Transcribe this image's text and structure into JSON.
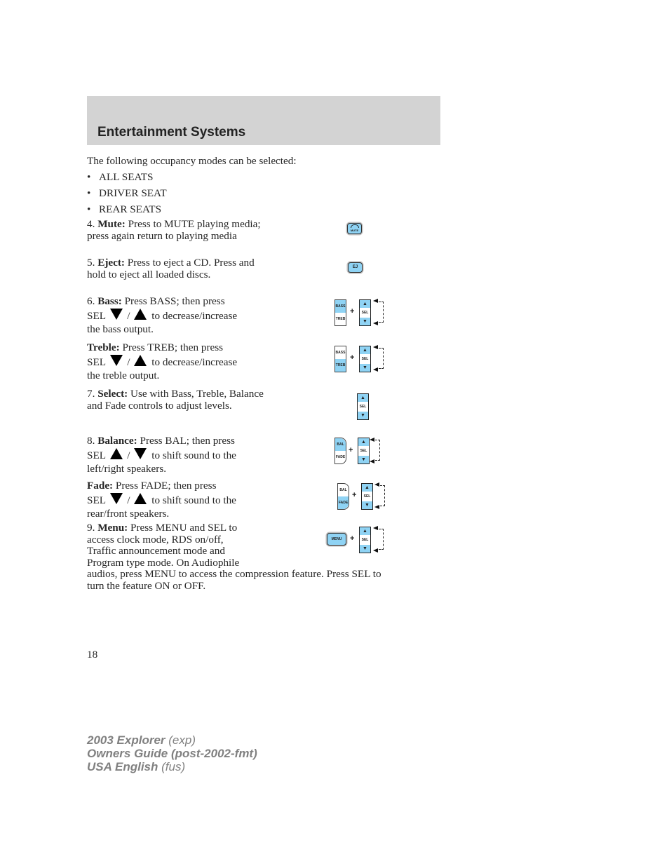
{
  "header": {
    "title": "Entertainment Systems"
  },
  "intro": "The following occupancy modes can be selected:",
  "occupancy_modes": [
    "ALL SEATS",
    "DRIVER SEAT",
    "REAR SEATS"
  ],
  "items": {
    "mute": {
      "num": "4.",
      "term": "Mute:",
      "text": "Press to MUTE playing media; press again return to playing media",
      "button_label": "MUTE"
    },
    "eject": {
      "num": "5.",
      "term": "Eject:",
      "text": "Press to eject a CD. Press and hold to eject all loaded discs.",
      "button_label": "EJ"
    },
    "bass": {
      "num": "6.",
      "term": "Bass:",
      "text_a": "Press BASS; then press",
      "text_b": "SEL",
      "text_c": "to decrease/increase",
      "text_d": "the bass output."
    },
    "treble": {
      "term": "Treble:",
      "text_a": "Press TREB; then press",
      "text_b": "SEL",
      "text_c": "to decrease/increase",
      "text_d": "the treble output."
    },
    "select": {
      "num": "7.",
      "term": "Select:",
      "text": "Use with Bass, Treble, Balance and Fade controls to adjust levels."
    },
    "balance": {
      "num": "8.",
      "term": "Balance:",
      "text_a": "Press BAL; then press",
      "text_b": "SEL",
      "text_c": "to shift sound to the",
      "text_d": "left/right speakers."
    },
    "fade": {
      "term": "Fade:",
      "text_a": "Press FADE; then press",
      "text_b": "SEL",
      "text_c": "to shift sound to the",
      "text_d": "rear/front speakers."
    },
    "menu": {
      "num": "9.",
      "term": "Menu:",
      "lines": [
        "Press MENU and SEL to",
        "access clock mode, RDS on/off,",
        "Traffic announcement mode and",
        "Program type mode. On Audiophile",
        "audios, press MENU to access the compression feature. Press SEL to",
        "turn the feature ON or OFF."
      ]
    }
  },
  "slash": "/",
  "buttons": {
    "bass": "BASS",
    "treb": "TREB",
    "sel": "SEL",
    "bal": "BAL",
    "fade": "FADE",
    "menu": "MENU",
    "up": "▲",
    "down": "▼",
    "plus": "+"
  },
  "colors": {
    "button_blue": "#8fd3f4",
    "header_gray": "#d3d3d3",
    "footer_gray": "#808080"
  },
  "page_number": "18",
  "footer": {
    "line1_bold": "2003 Explorer",
    "line1_code": "(exp)",
    "line2_bold": "Owners Guide (post-2002-fmt)",
    "line3_bold": "USA English",
    "line3_code": "(fus)"
  }
}
